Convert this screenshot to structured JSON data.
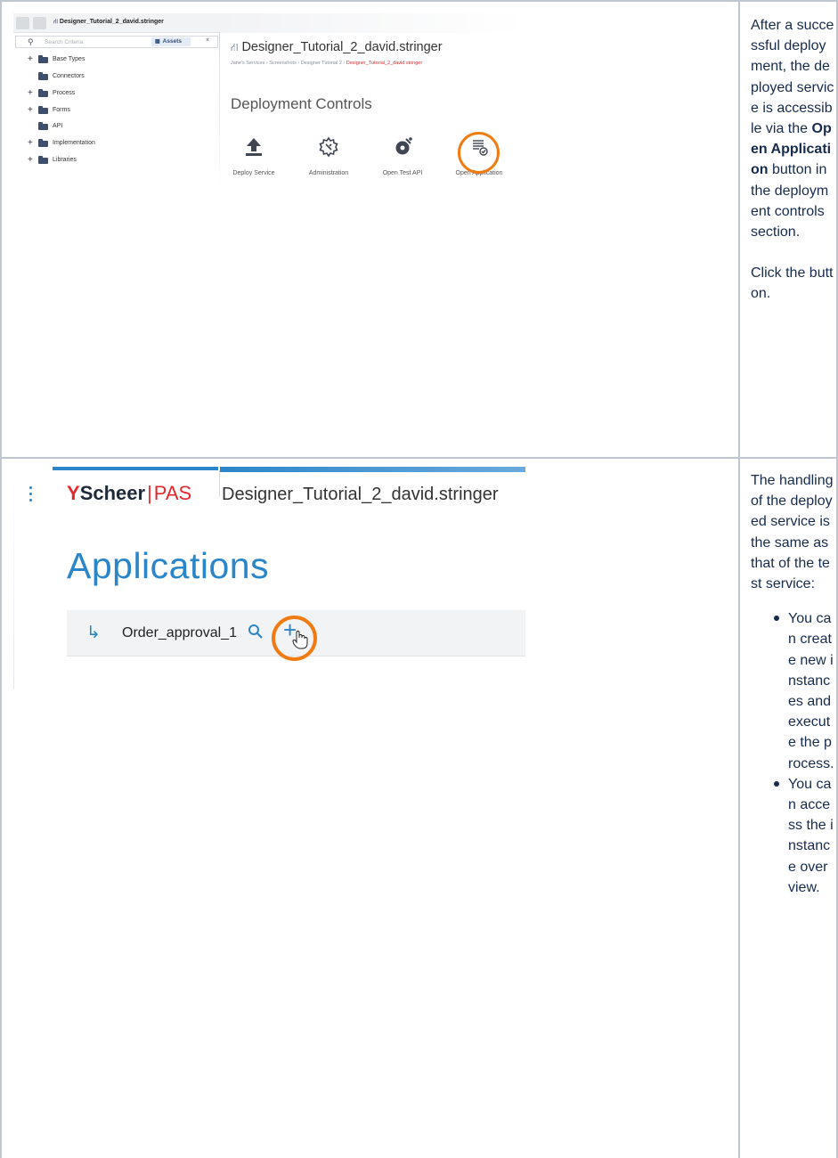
{
  "rows": [
    {
      "description": {
        "line1": "After a successful deployment, the deployed service is accessible via the",
        "bold": "Open Application",
        "line2": "button in the deployment controls section.",
        "line3": "Click the button."
      }
    },
    {
      "description": {
        "intro": "The handling of the deployed service is the same as that of the test service:",
        "bullets": [
          "You can create new instances and execute the process.",
          "You can access the instance overview."
        ]
      }
    }
  ],
  "screenshot1": {
    "tab_title": "Designer_Tutorial_2_david.stringer",
    "search_placeholder": "Search Criteria",
    "assets_label": "Assets",
    "close_label": "×",
    "tree": [
      {
        "label": "Base Types",
        "expandable": true
      },
      {
        "label": "Connectors",
        "expandable": false
      },
      {
        "label": "Process",
        "expandable": true
      },
      {
        "label": "Forms",
        "expandable": true
      },
      {
        "label": "API",
        "expandable": false
      },
      {
        "label": "Implementation",
        "expandable": true
      },
      {
        "label": "Libraries",
        "expandable": true
      }
    ],
    "service_title": "Designer_Tutorial_2_david.stringer",
    "breadcrumb": [
      "Jane's Services",
      "Screenshots",
      "Designer Tutorial 2"
    ],
    "breadcrumb_active": "Designer_Tutorial_2_david.stringer",
    "section_title": "Deployment Controls",
    "controls": [
      {
        "label": "Deploy Service",
        "icon": "upload-icon"
      },
      {
        "label": "Administration",
        "icon": "gear-wrench-icon"
      },
      {
        "label": "Open Test API",
        "icon": "api-gear-icon"
      },
      {
        "label": "Open Application",
        "icon": "application-icon"
      }
    ],
    "highlight_color": "#f07b12"
  },
  "screenshot2": {
    "logo_text": "Scheer",
    "logo_sep": "|",
    "logo_product": "PAS",
    "service_title": "Designer_Tutorial_2_david.stringer",
    "heading": "Applications",
    "app_name": "Order_approval_1",
    "accent_color": "#2b86c9",
    "highlight_color": "#f07b12"
  }
}
